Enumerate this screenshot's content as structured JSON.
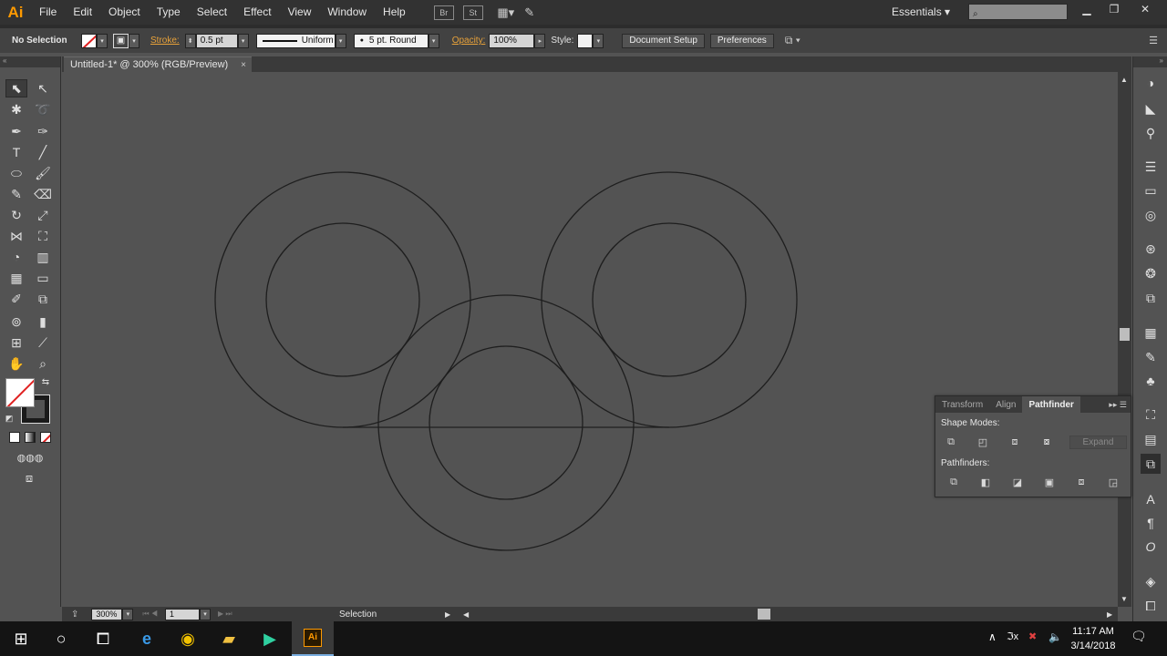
{
  "app": {
    "logo": "Ai",
    "menu": [
      "File",
      "Edit",
      "Object",
      "Type",
      "Select",
      "Effect",
      "View",
      "Window",
      "Help"
    ],
    "bridge_label": "Br",
    "stock_label": "St",
    "workspace": "Essentials",
    "search_placeholder": ""
  },
  "control_bar": {
    "selection_state": "No Selection",
    "stroke_label": "Stroke:",
    "stroke_value": "0.5 pt",
    "profile": "Uniform",
    "brush": "5 pt. Round",
    "opacity_label": "Opacity:",
    "opacity_value": "100%",
    "style_label": "Style:",
    "document_setup": "Document Setup",
    "preferences": "Preferences"
  },
  "document": {
    "tab_title": "Untitled-1* @ 300% (RGB/Preview)",
    "close": "×"
  },
  "status": {
    "zoom": "300%",
    "artboard": "1",
    "tool": "Selection"
  },
  "pathfinder_panel": {
    "tabs": [
      "Transform",
      "Align",
      "Pathfinder"
    ],
    "active_tab": "Pathfinder",
    "shape_modes_label": "Shape Modes:",
    "expand_label": "Expand",
    "pathfinders_label": "Pathfinders:"
  },
  "taskbar": {
    "time": "11:17 AM",
    "date": "3/14/2018"
  },
  "colors": {
    "accent_orange": "#ff9a00",
    "canvas": "#535353",
    "stroke": "#1e1e1e"
  }
}
